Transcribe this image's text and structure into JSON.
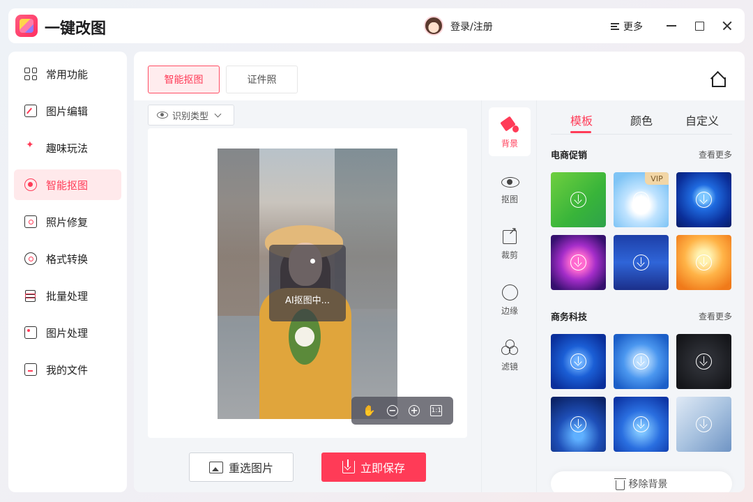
{
  "app": {
    "title": "一键改图"
  },
  "header": {
    "login_label": "登录/注册",
    "more_label": "更多"
  },
  "sidebar": {
    "items": [
      {
        "label": "常用功能",
        "icon": "grid-icon",
        "active": false
      },
      {
        "label": "图片编辑",
        "icon": "edit-icon",
        "active": false
      },
      {
        "label": "趣味玩法",
        "icon": "magic-wand-icon",
        "active": false
      },
      {
        "label": "智能抠图",
        "icon": "smart-cutout-icon",
        "active": true
      },
      {
        "label": "照片修复",
        "icon": "photo-repair-icon",
        "active": false
      },
      {
        "label": "格式转换",
        "icon": "format-convert-icon",
        "active": false
      },
      {
        "label": "批量处理",
        "icon": "layers-icon",
        "active": false
      },
      {
        "label": "图片处理",
        "icon": "image-icon",
        "active": false
      },
      {
        "label": "我的文件",
        "icon": "file-icon",
        "active": false
      }
    ]
  },
  "main": {
    "tabs": [
      {
        "label": "智能抠图",
        "active": true
      },
      {
        "label": "证件照",
        "active": false
      }
    ],
    "recognize_type_label": "识别类型",
    "processing_text": "AI抠图中...",
    "zoom_ratio_label": "1:1",
    "reselect_label": "重选图片",
    "save_label": "立即保存"
  },
  "tools": [
    {
      "label": "背景",
      "icon": "paint-bucket-icon",
      "active": true
    },
    {
      "label": "抠图",
      "icon": "eye-sparkle-icon",
      "active": false
    },
    {
      "label": "裁剪",
      "icon": "crop-icon",
      "active": false
    },
    {
      "label": "边缘",
      "icon": "edge-icon",
      "active": false
    },
    {
      "label": "滤镜",
      "icon": "filter-icon",
      "active": false
    }
  ],
  "right_panel": {
    "tabs": [
      {
        "label": "模板",
        "active": true
      },
      {
        "label": "颜色",
        "active": false
      },
      {
        "label": "自定义",
        "active": false
      }
    ],
    "sections": [
      {
        "title": "电商促销",
        "more_label": "查看更多"
      },
      {
        "title": "商务科技",
        "more_label": "查看更多"
      }
    ],
    "vip_badge": "VIP",
    "remove_bg_label": "移除背景"
  },
  "colors": {
    "accent": "#ff3b57",
    "accent_light": "#ffe9eb"
  }
}
